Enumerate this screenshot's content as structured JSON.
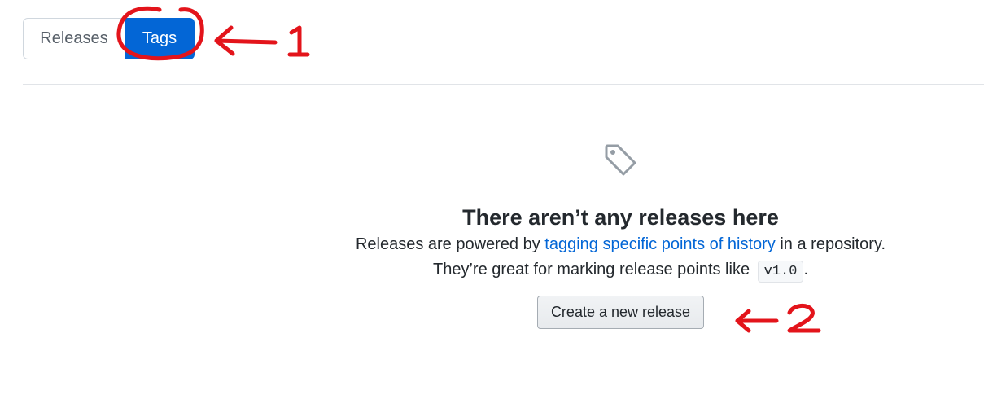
{
  "tabs": {
    "releases_label": "Releases",
    "tags_label": "Tags"
  },
  "blankslate": {
    "icon": "tag-icon",
    "title": "There aren’t any releases here",
    "line1_before": "Releases are powered by ",
    "line1_link": "tagging specific points of history",
    "line1_after": " in a repository.",
    "line2_before": "They’re great for marking release points like ",
    "line2_code": "v1.0",
    "line2_after": ".",
    "button_label": "Create a new release"
  },
  "annotations": {
    "marker_1": "1",
    "marker_2": "2",
    "color": "#e3141b"
  },
  "colors": {
    "accent": "#0366d6",
    "text": "#24292e",
    "muted": "#586069"
  }
}
